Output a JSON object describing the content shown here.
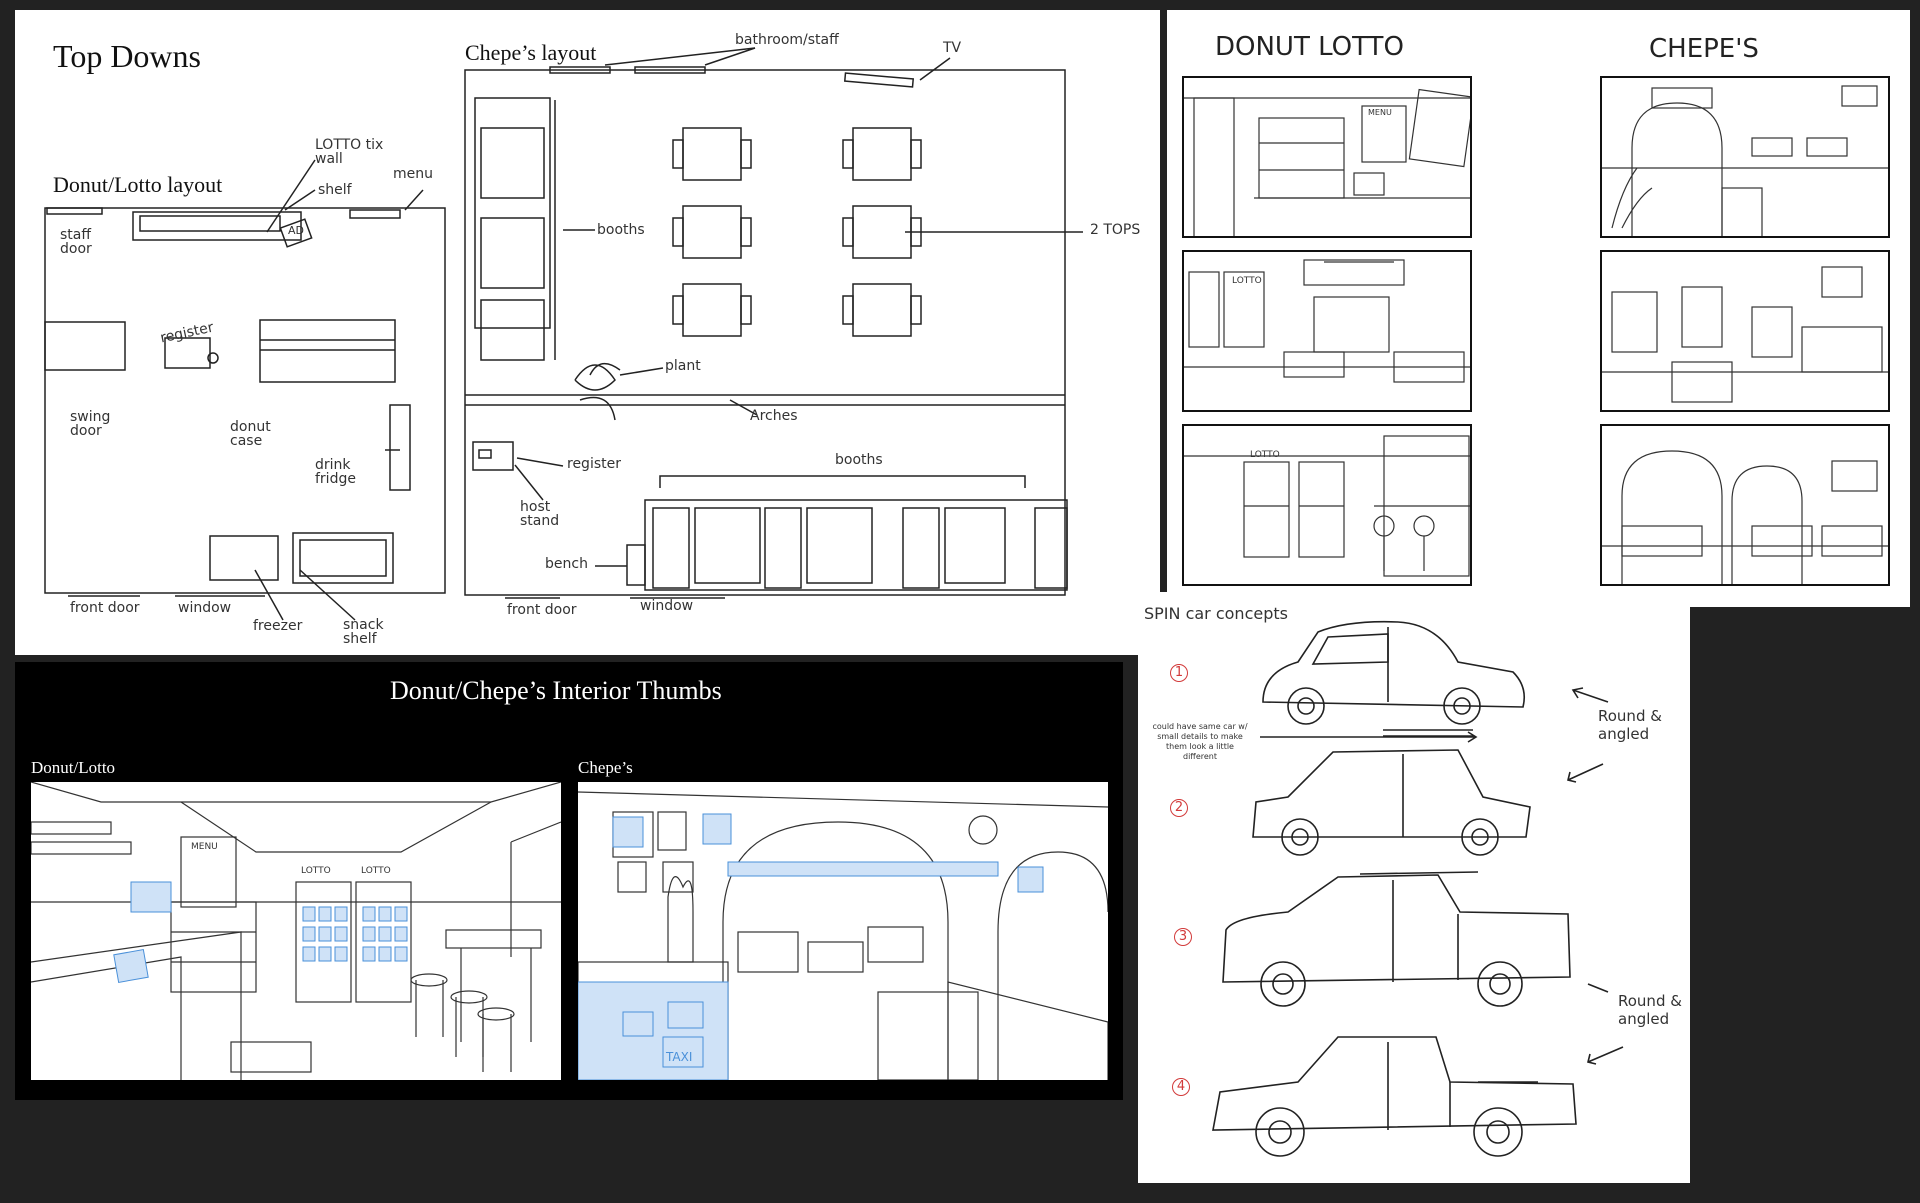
{
  "topdowns": {
    "title": "Top Downs",
    "donut_layout_title": "Donut/Lotto layout",
    "chepes_layout_title": "Chepe’s layout",
    "donut_labels": {
      "lotto_wall": "LOTTO tix wall",
      "shelf": "shelf",
      "menu": "menu",
      "staff_door": "staff door",
      "ad": "AD",
      "register": "register",
      "swing_door": "swing door",
      "donut_case": "donut case",
      "drink_fridge": "drink fridge",
      "front_door": "front door",
      "window": "window",
      "freezer": "freezer",
      "snack_shelf": "snack shelf"
    },
    "chepes_labels": {
      "bathroom_staff": "bathroom/staff",
      "tv": "TV",
      "booths_left": "booths",
      "two_tops": "2 TOPS",
      "plant": "plant",
      "arches": "Arches",
      "register": "register",
      "host_stand": "host stand",
      "booths_bottom": "booths",
      "bench": "bench",
      "front_door": "front door",
      "window": "window"
    }
  },
  "storyboard": {
    "donut_header": "DONUT LOTTO",
    "chepes_header": "CHEPE'S",
    "lotto_sign": "LOTTO",
    "menu_sign": "MENU"
  },
  "interior": {
    "title": "Donut/Chepe’s Interior Thumbs",
    "donut_label": "Donut/Lotto",
    "chepes_label": "Chepe’s",
    "menu_sign": "MENU",
    "lotto_sign_1": "LOTTO",
    "lotto_sign_2": "LOTTO",
    "taxi_sign": "TAXI"
  },
  "cars": {
    "title": "SPIN car concepts",
    "note": "could have same car w/ small details to make them look a little different",
    "numbers": [
      "1",
      "2",
      "3",
      "4"
    ],
    "label_a": "Round & angled",
    "label_b": "Round & angled"
  },
  "colors": {
    "background": "#222222",
    "paper": "#ffffff",
    "ink": "#111111",
    "blue_accent": "#4a90d9",
    "red_number": "#d23a3a"
  }
}
